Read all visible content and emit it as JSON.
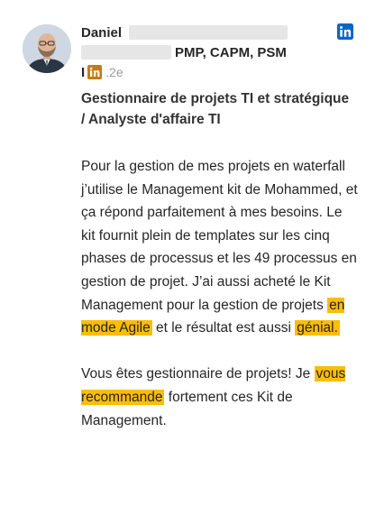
{
  "author": {
    "first_name": "Daniel",
    "certifications": "PMP, CAPM, PSM",
    "separator": "I",
    "connection_degree": ".2e"
  },
  "headline": "Gestionnaire de projets TI et stratégique / Analyste d'affaire TI",
  "body": {
    "p1_a": "Pour la gestion de mes projets en waterfall j’utilise le Management kit de Mohammed, et ça répond parfaitement à mes besoins. Le kit fournit plein de templates sur les cinq phases de processus et les 49 processus en gestion de projet. J’ai aussi acheté le Kit Management pour la gestion de projets ",
    "p1_hl1": "en mode Agile",
    "p1_b": " et le résultat est aussi ",
    "p1_hl2": "génial.",
    "p2_a": "Vous êtes gestionnaire de projets! Je ",
    "p2_hl": "vous recommande",
    "p2_b": " fortement ces Kit de Management."
  },
  "colors": {
    "linkedin_blue": "#0a66c2",
    "linkedin_gold": "#c37d16",
    "highlight": "#fbbd08"
  },
  "icons": {
    "corner": "linkedin-icon",
    "badge": "linkedin-icon"
  }
}
